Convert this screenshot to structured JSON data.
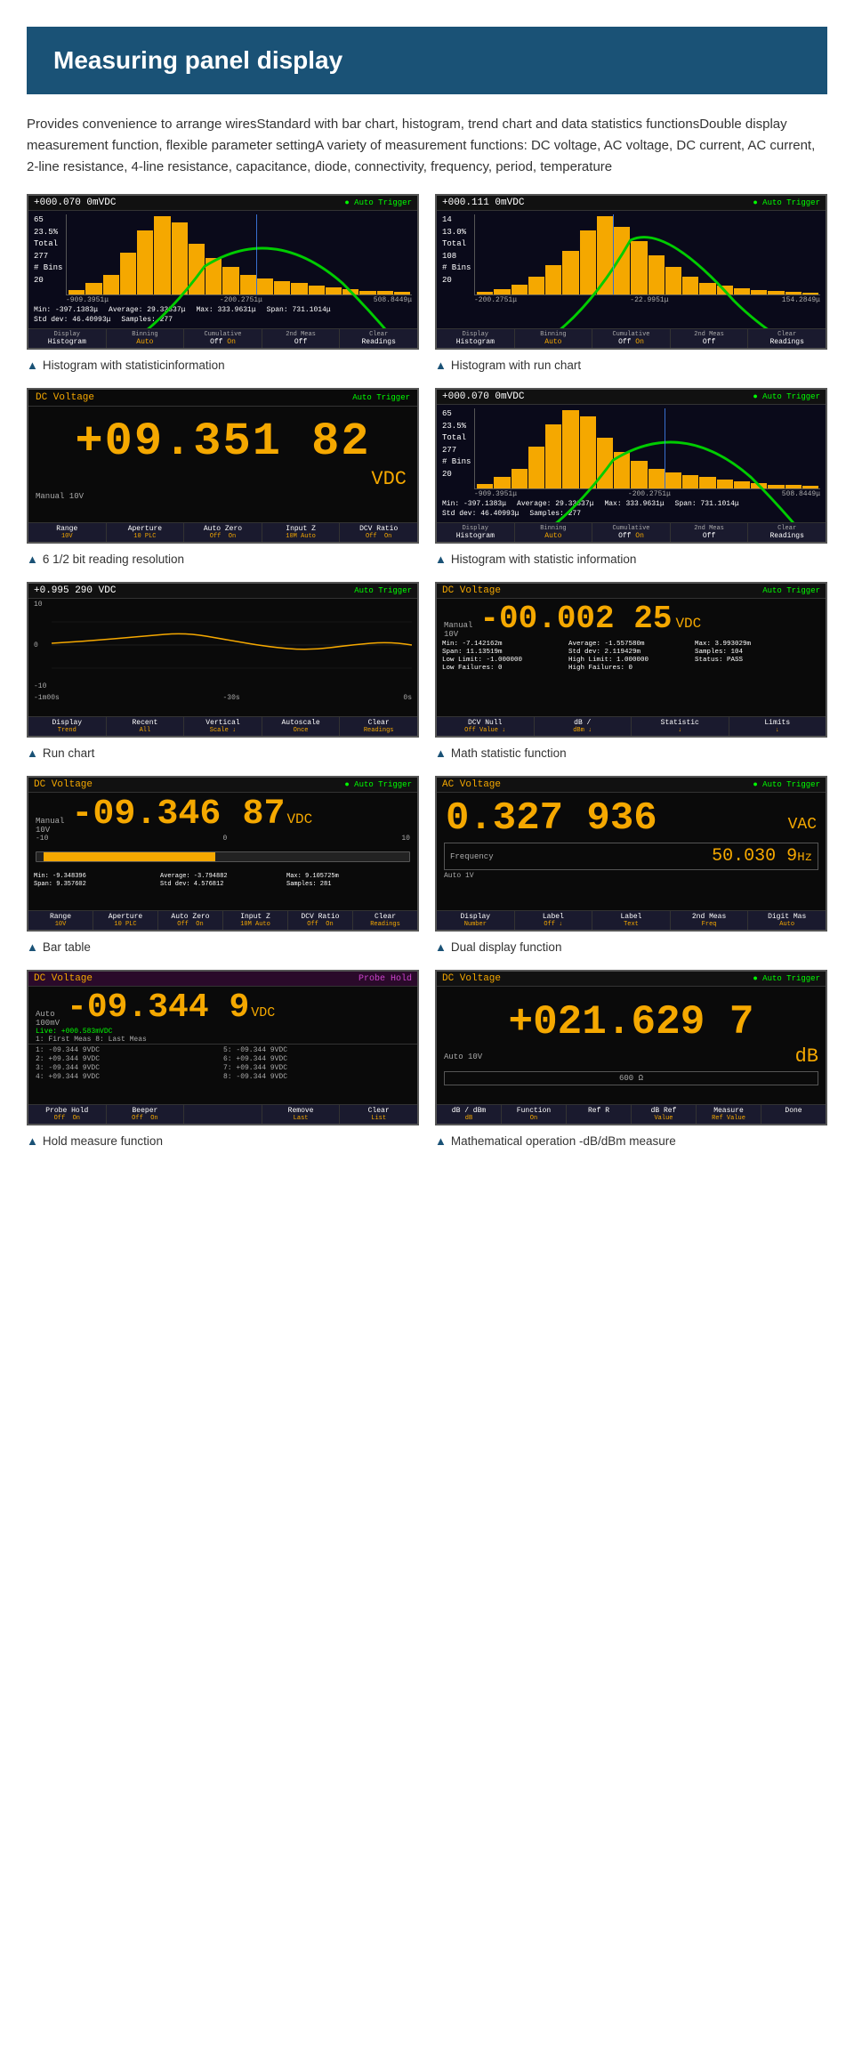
{
  "page": {
    "title": "Measuring panel display",
    "description": "Provides convenience to arrange wiresStandard with bar chart, histogram, trend chart and data statistics functionsDouble display measurement function, flexible parameter settingA variety of measurement functions: DC voltage, AC voltage, DC current, AC current, 2-line resistance, 4-line resistance, capacitance, diode, connectivity, frequency, period, temperature"
  },
  "panels": [
    {
      "id": "hist1",
      "caption": "Histogram with statisticinformation",
      "type": "histogram",
      "voltage": "+000.070 0mVDC",
      "trigger": "Auto Trigger",
      "pct": "23.5%",
      "total_label": "Total",
      "total_val": "277",
      "bins_label": "# Bins",
      "bins_val": "20",
      "x_labels": [
        "-909.3951μ",
        "-200.2751μ",
        "508.8449μ"
      ],
      "stat_rows": [
        "Min: -397.1383μ    Average: 29.33837μ    Max: 333.9631μ",
        "Span: 731.1014μ    Std dev: 46.40993μ    Samples: 277"
      ],
      "btns": [
        "Display\nHistogram",
        "Binning\nAuto",
        "Cumulative\nOff  On",
        "2nd Meas\nOff",
        "Clear\nReadings"
      ],
      "bars": [
        5,
        12,
        22,
        45,
        70,
        85,
        78,
        55,
        40,
        30,
        22,
        18,
        15,
        12,
        10,
        8,
        6,
        5,
        4,
        3
      ]
    },
    {
      "id": "hist2",
      "caption": "Histogram with run chart",
      "type": "histogram2",
      "voltage": "+000.111 0mVDC",
      "trigger": "Auto Trigger",
      "pct": "13.0%",
      "total_label": "Total",
      "total_val": "108",
      "bins_label": "# Bins",
      "bins_val": "20",
      "x_labels": [
        "-200.2751μ",
        "-22.9951μ",
        "154.2849μ"
      ],
      "btns": [
        "Display\nHistogram",
        "Binning\nAuto",
        "Cumulative\nOff  On",
        "2nd Meas\nOff",
        "Clear\nReadings"
      ],
      "bars": [
        3,
        6,
        10,
        18,
        30,
        45,
        65,
        80,
        70,
        55,
        40,
        28,
        18,
        12,
        9,
        7,
        5,
        4,
        3,
        2
      ]
    },
    {
      "id": "large1",
      "caption": "6 1/2 bit reading resolution",
      "type": "large",
      "top_label": "DC Voltage",
      "trigger": "Auto Trigger",
      "reading": "+09.351 82",
      "unit": "VDC",
      "manual": "Manual 10V",
      "btns": [
        {
          "top": "Range",
          "bot": "10V"
        },
        {
          "top": "Aperture",
          "bot": "10 PLC"
        },
        {
          "top": "Auto Zero",
          "bot": "Off  On"
        },
        {
          "top": "Input Z",
          "bot": "10M Auto"
        },
        {
          "top": "DCV Ratio",
          "bot": "Off  On"
        }
      ]
    },
    {
      "id": "hist3",
      "caption": "Histogram with statistic information",
      "type": "histogram",
      "voltage": "+000.070 0mVDC",
      "trigger": "Auto Trigger",
      "pct": "23.5%",
      "total_label": "Total",
      "total_val": "277",
      "bins_label": "# Bins",
      "bins_val": "20",
      "x_labels": [
        "-909.3951μ",
        "-200.2751μ",
        "508.8449μ"
      ],
      "stat_rows": [
        "Min: -397.1383μ    Average: 29.33837μ    Max: 333.9631μ",
        "Span: 731.1014μ    Std dev: 46.40993μ    Samples: 277"
      ],
      "btns": [
        "Display\nHistogram",
        "Binning\nAuto",
        "Cumulative\nOff  On",
        "2nd Meas\nOff",
        "Clear\nReadings"
      ],
      "bars": [
        5,
        12,
        22,
        45,
        70,
        85,
        78,
        55,
        40,
        30,
        22,
        18,
        15,
        12,
        10,
        8,
        6,
        5,
        4,
        3
      ]
    },
    {
      "id": "run1",
      "caption": "Run chart",
      "type": "run",
      "voltage": "+0.995 290  VDC",
      "trigger": "Auto Trigger",
      "y_labels": [
        "10",
        "0",
        "-10"
      ],
      "x_labels": [
        "-1m00s",
        "-30s",
        "0s"
      ],
      "btns": [
        {
          "top": "Display",
          "bot": "Trend"
        },
        {
          "top": "Recent",
          "bot": "All"
        },
        {
          "top": "Vertical",
          "bot": "Scale"
        },
        {
          "top": "Autoscale",
          "bot": "Once"
        },
        {
          "top": "Clear",
          "bot": "Readings"
        }
      ]
    },
    {
      "id": "stat1",
      "caption": "Math statistic function",
      "type": "stat",
      "top_label": "DC Voltage",
      "trigger": "Auto Trigger",
      "manual": "Manual\n10V",
      "reading": "-00.002 25",
      "unit": "VDC",
      "stats": [
        "Min: -7.142162m",
        "Average: -1.557580m",
        "Max: 3.993029m",
        "Span: 11.13519m",
        "Std dev: 2.119429m",
        "Samples: 104",
        "Low Limit: -1.000000",
        "High Limit: 1.000000",
        "Status: PASS",
        "Low Failures: 0",
        "High Failures: 0",
        ""
      ],
      "btns": [
        {
          "top": "DCV Null",
          "bot": "Off  Value"
        },
        {
          "top": "dB /",
          "bot": "dBm"
        },
        {
          "top": "Statistic",
          "bot": ""
        },
        {
          "top": "Limits",
          "bot": ""
        }
      ]
    },
    {
      "id": "bar1",
      "caption": "Bar table",
      "type": "bartable",
      "top_label": "DC Voltage",
      "trigger": "Auto Trigger",
      "manual": "Manual\n10V",
      "reading": "-09.346 87",
      "unit": "VDC",
      "ticks": [
        "-10",
        "0",
        "10"
      ],
      "stats": [
        "Min: -9.348396",
        "Average: -3.794882",
        "Max: 9.105725m",
        "Span: 9.357602",
        "Std dev: 4.576812",
        "Samples: 281"
      ],
      "btns": [
        {
          "top": "Range",
          "bot": "10V"
        },
        {
          "top": "Aperture",
          "bot": "10 PLC"
        },
        {
          "top": "Auto Zero",
          "bot": "Off  On"
        },
        {
          "top": "Input Z",
          "bot": "10M Auto"
        },
        {
          "top": "DCV Ratio",
          "bot": "Off  On"
        },
        {
          "top": "Clear",
          "bot": "Readings"
        }
      ]
    },
    {
      "id": "dual1",
      "caption": "Dual display function",
      "type": "dual",
      "top_label": "AC Voltage",
      "trigger": "Auto Trigger",
      "reading": "0.327 936",
      "unit": "VAC",
      "freq_label": "Frequency",
      "freq_val": "50.030 9",
      "freq_unit": "Hz",
      "auto": "Auto\n1V",
      "btns": [
        {
          "top": "Display",
          "bot": "Number"
        },
        {
          "top": "Label",
          "bot": "Off"
        },
        {
          "top": "Label",
          "bot": "Text"
        },
        {
          "top": "2nd Meas",
          "bot": "Freq"
        },
        {
          "top": "Digit Mas",
          "bot": "Auto"
        }
      ]
    },
    {
      "id": "hold1",
      "caption": "Hold measure function",
      "type": "hold",
      "top_label": "DC Voltage",
      "probe_hold": "Probe Hold",
      "reading": "-09.344 9",
      "unit": "VDC",
      "auto": "Auto\n100mV",
      "live": "Live: +000.583mVDC",
      "list_header": [
        "1: First Meas 8: Last Meas"
      ],
      "list_items": [
        "1: -09.344 9VDC",
        "5: -09.344 9VDC",
        "2: +09.344 9VDC",
        "6: +09.344 9VDC",
        "3: -09.344 9VDC",
        "7: +09.344 9VDC",
        "4: +09.344 9VDC",
        "8: -09.344 9VDC"
      ],
      "btns": [
        {
          "top": "Probe Hold",
          "bot": "Off  On"
        },
        {
          "top": "Beeper",
          "bot": "Off  On"
        },
        {
          "top": "",
          "bot": ""
        },
        {
          "top": "Remove",
          "bot": "Last"
        },
        {
          "top": "Clear",
          "bot": "List"
        }
      ]
    },
    {
      "id": "db1",
      "caption": "Mathematical operation -dB/dBm\nmeasure",
      "type": "db",
      "top_label": "DC Voltage",
      "trigger": "Auto Trigger",
      "reading": "+021.629 7",
      "unit": "dB",
      "auto": "Auto 10V",
      "ref_box": "600 Ω",
      "btns": [
        {
          "top": "dB / dBm",
          "bot": "dB"
        },
        {
          "top": "Function",
          "bot": "On"
        },
        {
          "top": "Ref R",
          "bot": ""
        },
        {
          "top": "dB Ref",
          "bot": "Value"
        },
        {
          "top": "Measure\nRef Value",
          "bot": ""
        },
        {
          "top": "Done",
          "bot": ""
        }
      ]
    }
  ]
}
